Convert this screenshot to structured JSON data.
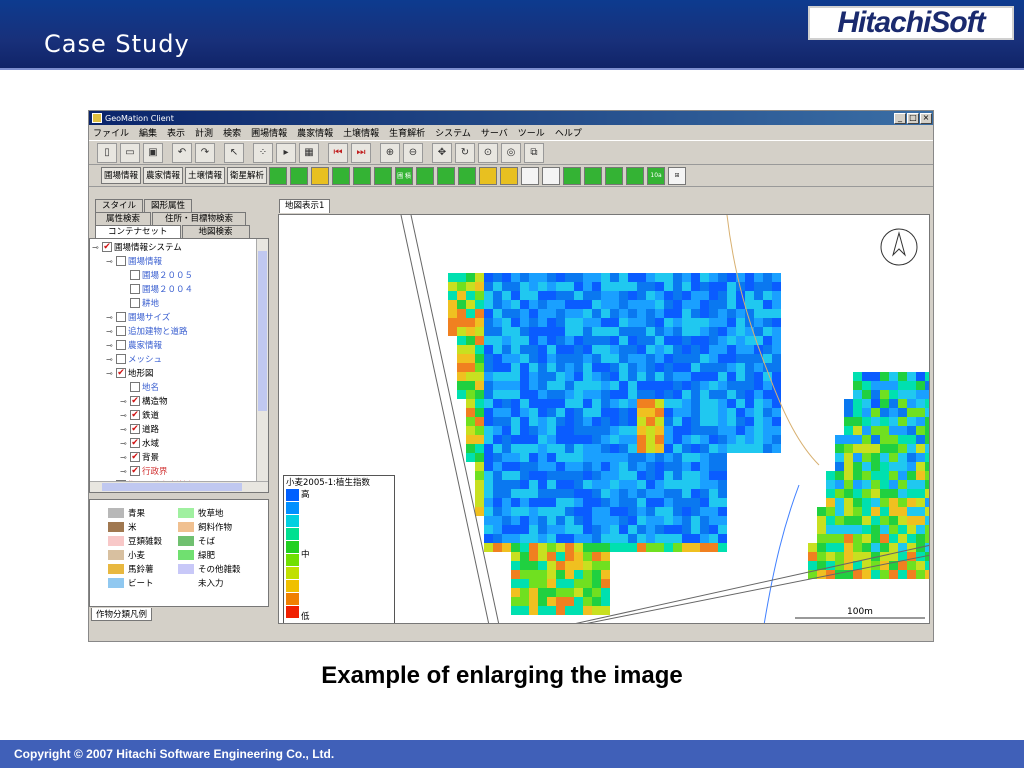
{
  "slide": {
    "title": "Case Study",
    "logo": "HitachiSoft",
    "caption": "Example of enlarging the image",
    "copyright": "Copyright © 2007 Hitachi Software Engineering Co., Ltd."
  },
  "window": {
    "title": "GeoMation Client",
    "menu": [
      "ファイル",
      "編集",
      "表示",
      "計測",
      "検索",
      "圃場情報",
      "農家情報",
      "土壌情報",
      "生育解析",
      "システム",
      "サーバ",
      "ツール",
      "ヘルプ"
    ],
    "toolbar2_text": [
      "圃場情報",
      "農家情報",
      "土壌情報",
      "衛星解析"
    ],
    "toolbar2_icons": [
      "圃\n積",
      "10a"
    ]
  },
  "left_panel": {
    "tabs_row1": [
      "スタイル",
      "図形属性"
    ],
    "tabs_row2": [
      "属性検索",
      "住所・目標物検索"
    ],
    "tabs_row3": [
      "コンテナセット",
      "地図検索"
    ],
    "tree": [
      {
        "label": "圃場情報システム",
        "checked": true,
        "style": "normal"
      },
      {
        "label": "圃場情報",
        "checked": false,
        "style": "blue"
      },
      {
        "label": "圃場２００５",
        "checked": false,
        "style": "blue"
      },
      {
        "label": "圃場２００４",
        "checked": false,
        "style": "blue"
      },
      {
        "label": "耕地",
        "checked": false,
        "style": "blue"
      },
      {
        "label": "圃場サイズ",
        "checked": false,
        "style": "blue"
      },
      {
        "label": "追加建物と道路",
        "checked": false,
        "style": "blue"
      },
      {
        "label": "農家情報",
        "checked": false,
        "style": "blue"
      },
      {
        "label": "メッシュ",
        "checked": false,
        "style": "blue"
      },
      {
        "label": "地形図",
        "checked": true,
        "style": "normal"
      },
      {
        "label": "地名",
        "checked": false,
        "style": "blue"
      },
      {
        "label": "構造物",
        "checked": true,
        "style": "normal"
      },
      {
        "label": "鉄道",
        "checked": true,
        "style": "normal"
      },
      {
        "label": "道路",
        "checked": true,
        "style": "normal"
      },
      {
        "label": "水域",
        "checked": true,
        "style": "normal"
      },
      {
        "label": "背景",
        "checked": true,
        "style": "normal"
      },
      {
        "label": "行政界",
        "checked": true,
        "style": "red"
      },
      {
        "label": "衛星画像解析情報",
        "checked": false,
        "style": "red"
      }
    ],
    "legend": [
      {
        "label": "青果",
        "color": "#b8b8b8"
      },
      {
        "label": "牧草地",
        "color": "#a0f0a0"
      },
      {
        "label": "米",
        "color": "#a07850"
      },
      {
        "label": "飼料作物",
        "color": "#f0c090"
      },
      {
        "label": "豆類雑穀",
        "color": "#f8c8c8"
      },
      {
        "label": "そば",
        "color": "#70c070"
      },
      {
        "label": "小麦",
        "color": "#d8c0a0"
      },
      {
        "label": "緑肥",
        "color": "#70e070"
      },
      {
        "label": "馬鈴薯",
        "color": "#e8b840"
      },
      {
        "label": "その他雑穀",
        "color": "#c8c8f8"
      },
      {
        "label": "ビート",
        "color": "#90c8f0"
      },
      {
        "label": "未入力",
        "color": "#ffffff"
      }
    ],
    "legend_tab": "作物分類凡例"
  },
  "map": {
    "tab": "地図表示1",
    "scale_label": "100m",
    "index_legend": {
      "title": "小麦2005-1:植生指数",
      "high": "高",
      "mid": "中",
      "low": "低"
    }
  }
}
